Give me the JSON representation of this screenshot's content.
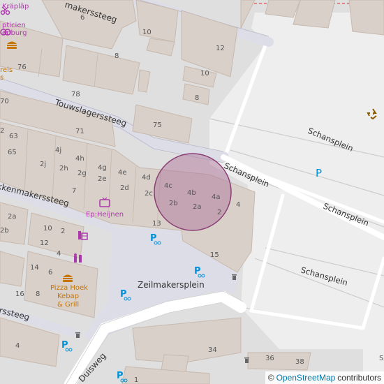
{
  "streets": {
    "makerssteeg_top": "makerssteeg",
    "touwslagerssteeg": "Touwslagerssteeg",
    "schansplein_road": "Schansplein",
    "schansplein_lot_1": "Schansplein",
    "schansplein_lot_2": "Schansplein",
    "schansplein_lot_3": "Schansplein",
    "kkenmakerssteeg": "kkenmakerssteeg",
    "zeilmakersplein": "Zeilmakersplein",
    "rssteeg": "rssteeg",
    "duisweg": "Duisweg"
  },
  "pois": {
    "kraplap": "Kräpläp",
    "opticien": "pticien",
    "enburg": "enburg",
    "rels": "rels",
    "s_edge": "s",
    "heijnen": "Ep:Heijnen",
    "pizza_line1": "Pizza Hoek",
    "pizza_line2": "Kebap",
    "pizza_line3": "& Grill"
  },
  "house_numbers": {
    "n6": "6",
    "n76": "76",
    "n10a": "10",
    "n8a": "8",
    "n12": "12",
    "n10b": "10",
    "n8b": "8",
    "n78": "78",
    "n70": "70",
    "n75": "75",
    "n71": "71",
    "n2a": "2",
    "n63": "63",
    "n65": "65",
    "n4j": "4j",
    "n4h": "4h",
    "n2j": "2j",
    "n2h": "2h",
    "n4g": "4g",
    "n2g": "2g",
    "n4e": "4e",
    "n2e": "2e",
    "n4d": "4d",
    "n2d": "2d",
    "n4c": "4c",
    "n2c": "2c",
    "n4b": "4b",
    "n4a": "4a",
    "n2b": "2b",
    "n2a2": "2a",
    "n2s": "2",
    "n4s": "4",
    "n7": "7",
    "n13": "13",
    "n15": "15",
    "n2aW": "2a",
    "n2bW": "2b",
    "n10c": "10",
    "n2w": "2",
    "n12w": "12",
    "n4w": "4",
    "n14": "14",
    "n6w": "6",
    "n16": "16",
    "n8w": "8",
    "n4bot": "4",
    "n34": "34",
    "n36": "36",
    "n38": "38",
    "n1": "1",
    "nS": "S"
  },
  "parking": {
    "large_p": "P"
  },
  "attribution": {
    "symbol": "©",
    "link_text": "OpenStreetMap",
    "suffix": "contributors"
  },
  "colors": {
    "background": "#e0dfdf",
    "building": "#d9d0c9",
    "building_stroke": "#c7b9ae",
    "road_white": "#ffffff",
    "footway": "#dddde8",
    "pedestrian_area": "#dddde8",
    "parking_lot": "#eeeeee",
    "highlight_circle_fill": "rgba(170,110,150,0.45)",
    "highlight_circle_stroke": "#8a3f74",
    "poi_purple": "#ac39ac",
    "parking_blue": "#0092da",
    "food_orange": "#c77400",
    "recycling_brown": "#8a5a00"
  },
  "icons": [
    "scissors-icon",
    "hamburger-icon",
    "tv-icon",
    "cosmetics-icon",
    "dry-cleaning-icon",
    "bicycle-parking-icon",
    "waste-basket-icon",
    "recycling-icon",
    "parking-icon"
  ]
}
